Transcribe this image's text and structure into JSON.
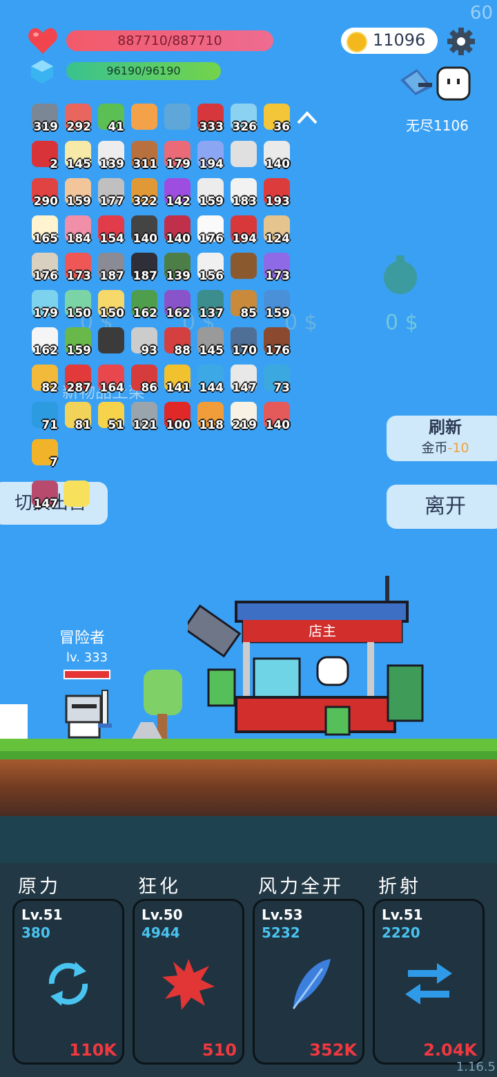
{
  "fps": "60",
  "hp": "887710/887710",
  "mp": "96190/96190",
  "coins": "11096",
  "endless": "无尽1106",
  "colors": {
    "hp": "#f25a6a",
    "mp": "#39c28f",
    "coin": "#f4b81d",
    "sky": "#3aa0f3",
    "accent_red": "#f0383f",
    "accent_blue": "#49c3ef"
  },
  "items": [
    {
      "c": "319",
      "col": "#7b8794",
      "icon": "sword-icon"
    },
    {
      "c": "292",
      "col": "#e8665d",
      "icon": "jar-icon"
    },
    {
      "c": "41",
      "col": "#5bbf53",
      "icon": "cash-icon"
    },
    {
      "c": "",
      "col": "#f3a24a",
      "icon": "crown-icon"
    },
    {
      "c": "",
      "col": "#5fa7d9",
      "icon": "magnifier-icon"
    },
    {
      "c": "333",
      "col": "#d5373d",
      "icon": "sock-icon"
    },
    {
      "c": "326",
      "col": "#8bd2f2",
      "icon": "card-icon"
    },
    {
      "c": "36",
      "col": "#f2c638",
      "icon": "crown-icon"
    },
    {
      "c": "2",
      "col": "#d83339",
      "icon": "magnet-icon"
    },
    {
      "c": "145",
      "col": "#f7e9a7",
      "icon": "halo-icon"
    },
    {
      "c": "139",
      "col": "#ededed",
      "icon": "cards-icon"
    },
    {
      "c": "311",
      "col": "#b8703f",
      "icon": "donut-icon"
    },
    {
      "c": "179",
      "col": "#ea6b77",
      "icon": "bottle-icon"
    },
    {
      "c": "194",
      "col": "#8ba6f2",
      "icon": "pill-icon"
    },
    {
      "c": "",
      "col": "#e0e0e0",
      "icon": "hook-icon"
    },
    {
      "c": "140",
      "col": "#eaeaea",
      "icon": "dice-icon"
    },
    {
      "c": "290",
      "col": "#e14343",
      "icon": "watermelon-icon"
    },
    {
      "c": "159",
      "col": "#f2c59a",
      "icon": "hand-icon"
    },
    {
      "c": "177",
      "col": "#c0c0c0",
      "icon": "wand-icon"
    },
    {
      "c": "322",
      "col": "#e09936",
      "icon": "book-icon"
    },
    {
      "c": "142",
      "col": "#9d4ee0",
      "icon": "orb-icon"
    },
    {
      "c": "159",
      "col": "#ececec",
      "icon": "bulb-icon"
    },
    {
      "c": "183",
      "col": "#f2f2f2",
      "icon": "mail-icon"
    },
    {
      "c": "193",
      "col": "#dc3c3c",
      "icon": "mushroom-icon"
    },
    {
      "c": "165",
      "col": "#fff3d0",
      "icon": "egg-icon"
    },
    {
      "c": "184",
      "col": "#f08fa7",
      "icon": "icecream-icon"
    },
    {
      "c": "154",
      "col": "#e23c4a",
      "icon": "gift-icon"
    },
    {
      "c": "140",
      "col": "#444",
      "icon": "pot-icon"
    },
    {
      "c": "140",
      "col": "#c0304a",
      "icon": "shield-icon"
    },
    {
      "c": "176",
      "col": "#fafafa",
      "icon": "ghost-icon"
    },
    {
      "c": "194",
      "col": "#d9383a",
      "icon": "tomato-icon"
    },
    {
      "c": "124",
      "col": "#e5c48e",
      "icon": "flag-icon"
    },
    {
      "c": "176",
      "col": "#d9d0c0",
      "icon": "coconut-icon"
    },
    {
      "c": "173",
      "col": "#ef5656",
      "icon": "capsule-icon"
    },
    {
      "c": "187",
      "col": "#8b8b95",
      "icon": "elephant-icon"
    },
    {
      "c": "187",
      "col": "#2f2f3a",
      "icon": "bat-icon"
    },
    {
      "c": "139",
      "col": "#4e7e47",
      "icon": "grenade-icon"
    },
    {
      "c": "156",
      "col": "#f0f0f0",
      "icon": "clock-icon"
    },
    {
      "c": "",
      "col": "#8a5a2e",
      "icon": "chest-icon"
    },
    {
      "c": "173",
      "col": "#8e6ae6",
      "icon": "box-icon"
    },
    {
      "c": "179",
      "col": "#7dd3ee",
      "icon": "cat-icon"
    },
    {
      "c": "150",
      "col": "#7bd4a6",
      "icon": "slime-icon"
    },
    {
      "c": "150",
      "col": "#f7d86a",
      "icon": "note-icon"
    },
    {
      "c": "162",
      "col": "#4f9e4e",
      "icon": "helmet-icon"
    },
    {
      "c": "162",
      "col": "#8953c9",
      "icon": "badge-icon"
    },
    {
      "c": "137",
      "col": "#3c8d8e",
      "icon": "disc-icon"
    },
    {
      "c": "85",
      "col": "#c98b3b",
      "icon": "bow-icon"
    },
    {
      "c": "159",
      "col": "#4a90d9",
      "icon": "scroll-icon"
    },
    {
      "c": "162",
      "col": "#f5f5f5",
      "icon": "clipboard-icon"
    },
    {
      "c": "159",
      "col": "#68b84a",
      "icon": "zombie-icon"
    },
    {
      "c": "",
      "col": "#3b3b3b",
      "icon": "hood-icon"
    },
    {
      "c": "93",
      "col": "#cccccc",
      "icon": "bag-icon"
    },
    {
      "c": "88",
      "col": "#d44040",
      "icon": "hook2-icon"
    },
    {
      "c": "145",
      "col": "#9a9a9a",
      "icon": "spike-icon"
    },
    {
      "c": "170",
      "col": "#4f6f97",
      "icon": "shield2-icon"
    },
    {
      "c": "176",
      "col": "#8b4a2e",
      "icon": "tombstone-icon"
    },
    {
      "c": "82",
      "col": "#f2b93b",
      "icon": "magic-icon"
    },
    {
      "c": "287",
      "col": "#e23a3a",
      "icon": "apple-icon"
    },
    {
      "c": "164",
      "col": "#e8474e",
      "icon": "heart-icon"
    },
    {
      "c": "86",
      "col": "#d63c3c",
      "icon": "heart2-icon"
    },
    {
      "c": "141",
      "col": "#f2c12e",
      "icon": "sunflower-icon"
    },
    {
      "c": "144",
      "col": "#3da8e6",
      "icon": "chat-icon"
    },
    {
      "c": "147",
      "col": "#e8e8e8",
      "icon": "meteor-icon"
    },
    {
      "c": "73",
      "col": "#3ca8e0",
      "icon": "target-icon"
    },
    {
      "c": "71",
      "col": "#2c9be0",
      "icon": "gem-icon"
    },
    {
      "c": "81",
      "col": "#f2d35a",
      "icon": "ring-icon"
    },
    {
      "c": "51",
      "col": "#f6d34b",
      "icon": "lightbulb-icon"
    },
    {
      "c": "121",
      "col": "#9aa4ad",
      "icon": "compass-icon"
    },
    {
      "c": "100",
      "col": "#e02828",
      "icon": "redcard-icon"
    },
    {
      "c": "118",
      "col": "#f09d3a",
      "icon": "parchment-icon"
    },
    {
      "c": "219",
      "col": "#f7f2e4",
      "icon": "fried-egg-icon"
    },
    {
      "c": "140",
      "col": "#e45a5a",
      "icon": "meat-icon"
    },
    {
      "c": "7",
      "col": "#f0b32a",
      "icon": "coins-icon"
    }
  ],
  "extra_items": [
    {
      "c": "147",
      "col": "#b84a6e",
      "icon": "fireworks-icon"
    },
    {
      "c": "",
      "col": "#f7e15c",
      "icon": "sparkle-icon"
    }
  ],
  "ghost_prices": [
    "0 $",
    "0 $",
    "0 $",
    "0 $"
  ],
  "ghost_banner": "新物品上架",
  "buttons": {
    "refresh": "刷新",
    "refresh_cost_label": "金币",
    "refresh_cost": "-10",
    "leave": "离开",
    "switch": "切换出售"
  },
  "adventurer": {
    "name": "冒险者",
    "level": "lv. 333"
  },
  "shop_sign": "店主",
  "skills": [
    {
      "name": "原力",
      "level": "Lv.51",
      "value": "380",
      "cost": "110K",
      "icon": "cycle-icon"
    },
    {
      "name": "狂化",
      "level": "Lv.50",
      "value": "4944",
      "cost": "510",
      "icon": "splat-icon"
    },
    {
      "name": "风力全开",
      "level": "Lv.53",
      "value": "5232",
      "cost": "352K",
      "icon": "feather-icon"
    },
    {
      "name": "折射",
      "level": "Lv.51",
      "value": "2220",
      "cost": "2.04K",
      "icon": "swap-arrows-icon"
    }
  ],
  "version": "1.16.5"
}
